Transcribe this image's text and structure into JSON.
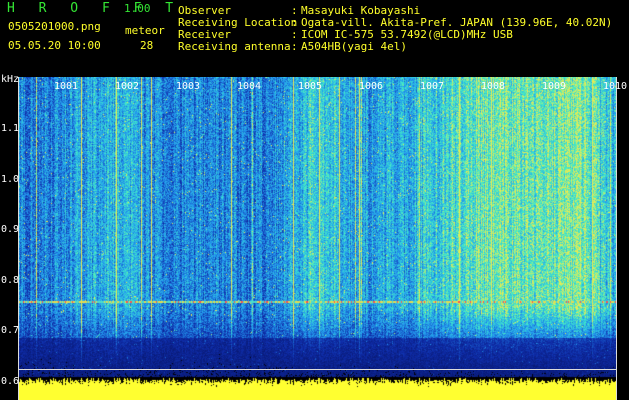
{
  "header": {
    "app_name": "H R O F F T",
    "version": "1.00",
    "filename": "0505201000.png",
    "datetime": "05.05.20 10:00",
    "mode_label": "meteor",
    "mode_value": "28"
  },
  "info": {
    "rows": [
      {
        "label": "Observer",
        "value": "Masayuki Kobayashi"
      },
      {
        "label": "Receiving Location",
        "value": "Ogata-vill. Akita-Pref. JAPAN (139.96E, 40.02N)"
      },
      {
        "label": "Receiver",
        "value": "ICOM IC-575 53.7492(@LCD)MHz USB"
      },
      {
        "label": "Receiving antenna",
        "value": "A504HB(yagi 4el)"
      }
    ],
    "colon": ":"
  },
  "spectrogram": {
    "unit": "kHz",
    "y_ticks": [
      "1.1",
      "1.0",
      "0.9",
      "0.8",
      "0.7",
      "0.6"
    ],
    "y_tick_values": [
      1.1,
      1.0,
      0.9,
      0.8,
      0.7,
      0.6
    ],
    "x_ticks": [
      "1001",
      "1002",
      "1003",
      "1004",
      "1005",
      "1006",
      "1007",
      "1008",
      "1009",
      "1010"
    ],
    "carrier_khz": 0.76,
    "frequency_range_khz": [
      0.59,
      1.19
    ],
    "colors": {
      "background": "#000000",
      "low": "#0a1e9c",
      "mid": "#1e6ee6",
      "high": "#32dcc8",
      "peak": "#e6e650",
      "carrier": "#ff5050",
      "noise_band": "#ffff30"
    }
  }
}
